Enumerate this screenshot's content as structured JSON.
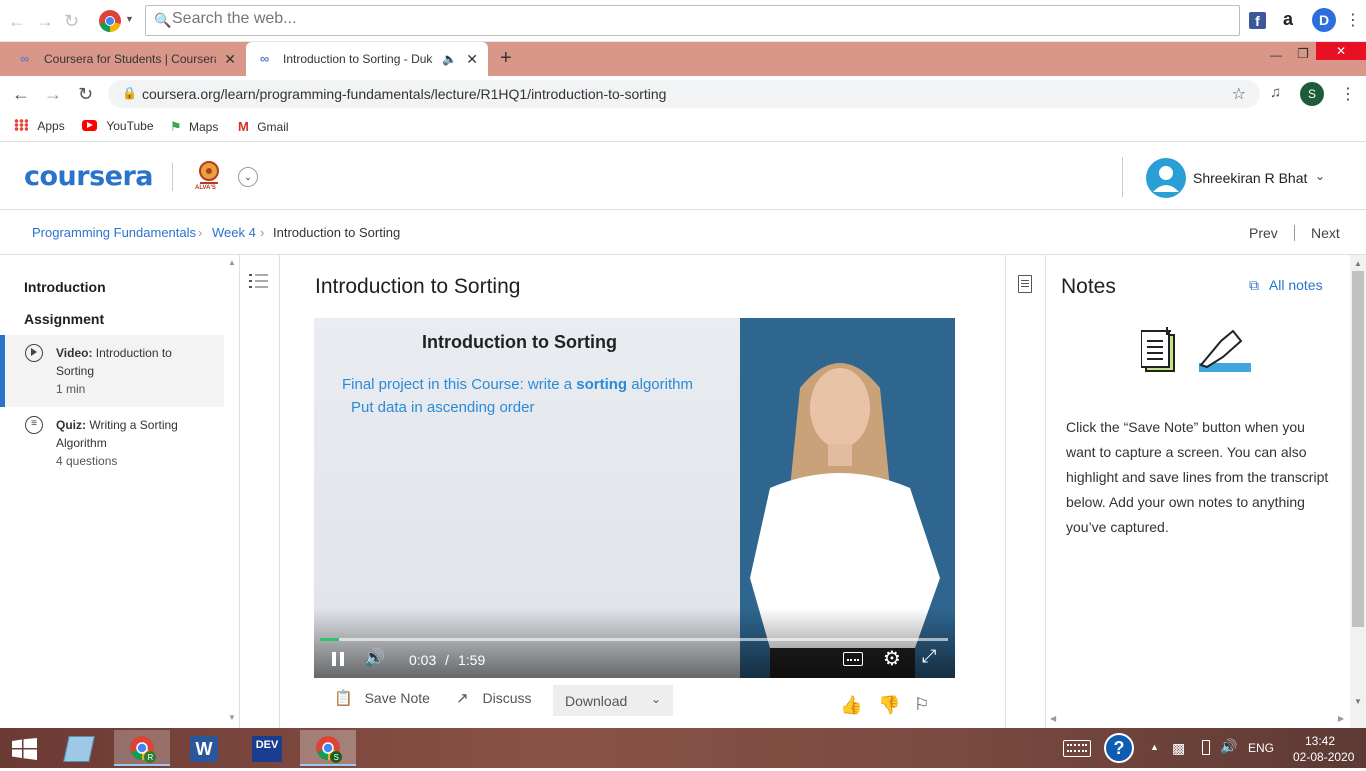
{
  "search_toolbar": {
    "placeholder": "Search the web..."
  },
  "tabs": [
    {
      "label": "Coursera for Students | Coursera",
      "close": "✕"
    },
    {
      "label": "Introduction to Sorting - Duk",
      "close": "✕"
    }
  ],
  "new_tab": "+",
  "window_controls": {
    "minimize": "—",
    "maximize": "❐",
    "close": "✕"
  },
  "address": {
    "url": "coursera.org/learn/programming-fundamentals/lecture/R1HQ1/introduction-to-sorting",
    "profile_initial": "S"
  },
  "bookmarks": [
    "Apps",
    "YouTube",
    "Maps",
    "Gmail"
  ],
  "header": {
    "logo": "coursera",
    "partner": "ALVA'S",
    "user_name": "Shreekiran R Bhat"
  },
  "breadcrumb": {
    "course": "Programming Fundamentals",
    "week": "Week 4",
    "current": "Introduction to Sorting",
    "prev": "Prev",
    "next": "Next"
  },
  "sidebar": {
    "section1": "Introduction",
    "section2": "Assignment",
    "items": [
      {
        "type_label": "Video:",
        "title": "Introduction to Sorting",
        "meta": "1 min"
      },
      {
        "type_label": "Quiz:",
        "title": "Writing a Sorting Algorithm",
        "meta": "4 questions"
      }
    ]
  },
  "lecture": {
    "title": "Introduction to Sorting",
    "slide_title": "Introduction to Sorting",
    "slide_line1_pre": "Final project in this Course: write a ",
    "slide_line1_bold": "sorting",
    "slide_line1_post": " algorithm",
    "slide_line2": "Put data in ascending order",
    "time_current": "0:03",
    "time_sep": "/",
    "time_total": "1:59",
    "progress": 0.03
  },
  "actions": {
    "save_note": "Save Note",
    "discuss": "Discuss",
    "download": "Download"
  },
  "notes": {
    "title": "Notes",
    "all_notes": "All notes",
    "body": "Click the “Save Note” button when you want to capture a screen. You can also highlight and save lines from the transcript below. Add your own notes to anything you’ve captured."
  },
  "taskbar": {
    "lang": "ENG",
    "time": "13:42",
    "date": "02-08-2020",
    "dev_label": "DEV",
    "word_label": "W"
  },
  "colors": {
    "tabstrip": "#d99789",
    "coursera_blue": "#2a73cc",
    "link_blue": "#2a73cc",
    "active_bar": "#2a73cc"
  }
}
